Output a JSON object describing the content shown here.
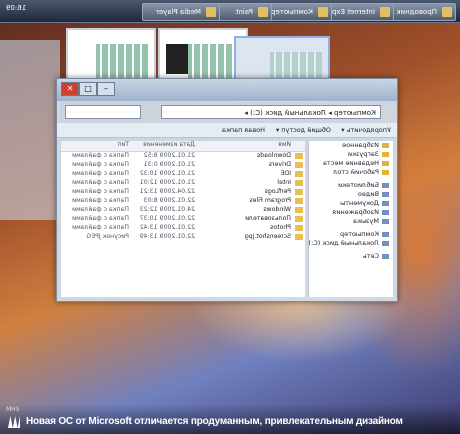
{
  "taskbar": {
    "buttons": [
      "Проводник",
      "Internet Explorer",
      "Компьютер",
      "Paint",
      "Media Player"
    ],
    "tray_time": "16:09"
  },
  "window": {
    "address": "Компьютер ▸ Локальный диск (C:) ▸",
    "toolbar": [
      "Упорядочить ▾",
      "Общий доступ ▾",
      "Новая папка"
    ],
    "nav_items": [
      {
        "label": "Избранное",
        "fav": true
      },
      {
        "label": "Загрузки",
        "fav": true
      },
      {
        "label": "Недавние места",
        "fav": true
      },
      {
        "label": "Рабочий стол",
        "fav": true
      },
      {
        "label": "Библиотеки",
        "fav": false
      },
      {
        "label": "Видео",
        "fav": false
      },
      {
        "label": "Документы",
        "fav": false
      },
      {
        "label": "Изображения",
        "fav": false
      },
      {
        "label": "Музыка",
        "fav": false
      },
      {
        "label": "Компьютер",
        "fav": false
      },
      {
        "label": "Локальный диск (C:)",
        "fav": false
      },
      {
        "label": "Сеть",
        "fav": false
      }
    ],
    "columns": [
      "Имя",
      "Дата изменения",
      "Тип"
    ],
    "rows": [
      {
        "name": "Downloads",
        "date": "21.01.2009 8:52",
        "type": "Папка с файлами"
      },
      {
        "name": "Drivers",
        "date": "21.01.2009 0:31",
        "type": "Папка с файлами"
      },
      {
        "name": "IDE",
        "date": "21.01.2009 10:32",
        "type": "Папка с файлами"
      },
      {
        "name": "Intel",
        "date": "21.01.2009 12:01",
        "type": "Папка с файлами"
      },
      {
        "name": "PerfLogs",
        "date": "22.04.2009 13:21",
        "type": "Папка с файлами"
      },
      {
        "name": "Program Files",
        "date": "22.01.2009 8:03",
        "type": "Папка с файлами"
      },
      {
        "name": "Windows",
        "date": "24.01.2009 12:23",
        "type": "Папка с файлами"
      },
      {
        "name": "Пользователи",
        "date": "22.01.2009 10:37",
        "type": "Папка с файлами"
      },
      {
        "name": "Photos",
        "date": "22.01.2009 13:42",
        "type": "Папка с файлами"
      },
      {
        "name": "Screenshot.jpg",
        "date": "22.01.2009 13:49",
        "type": "Рисунок JPEG"
      }
    ]
  },
  "caption": {
    "text": "Новая ОС от Microsoft отличается продуманным, привлекательным дизайном",
    "page_tag": "MHS"
  }
}
